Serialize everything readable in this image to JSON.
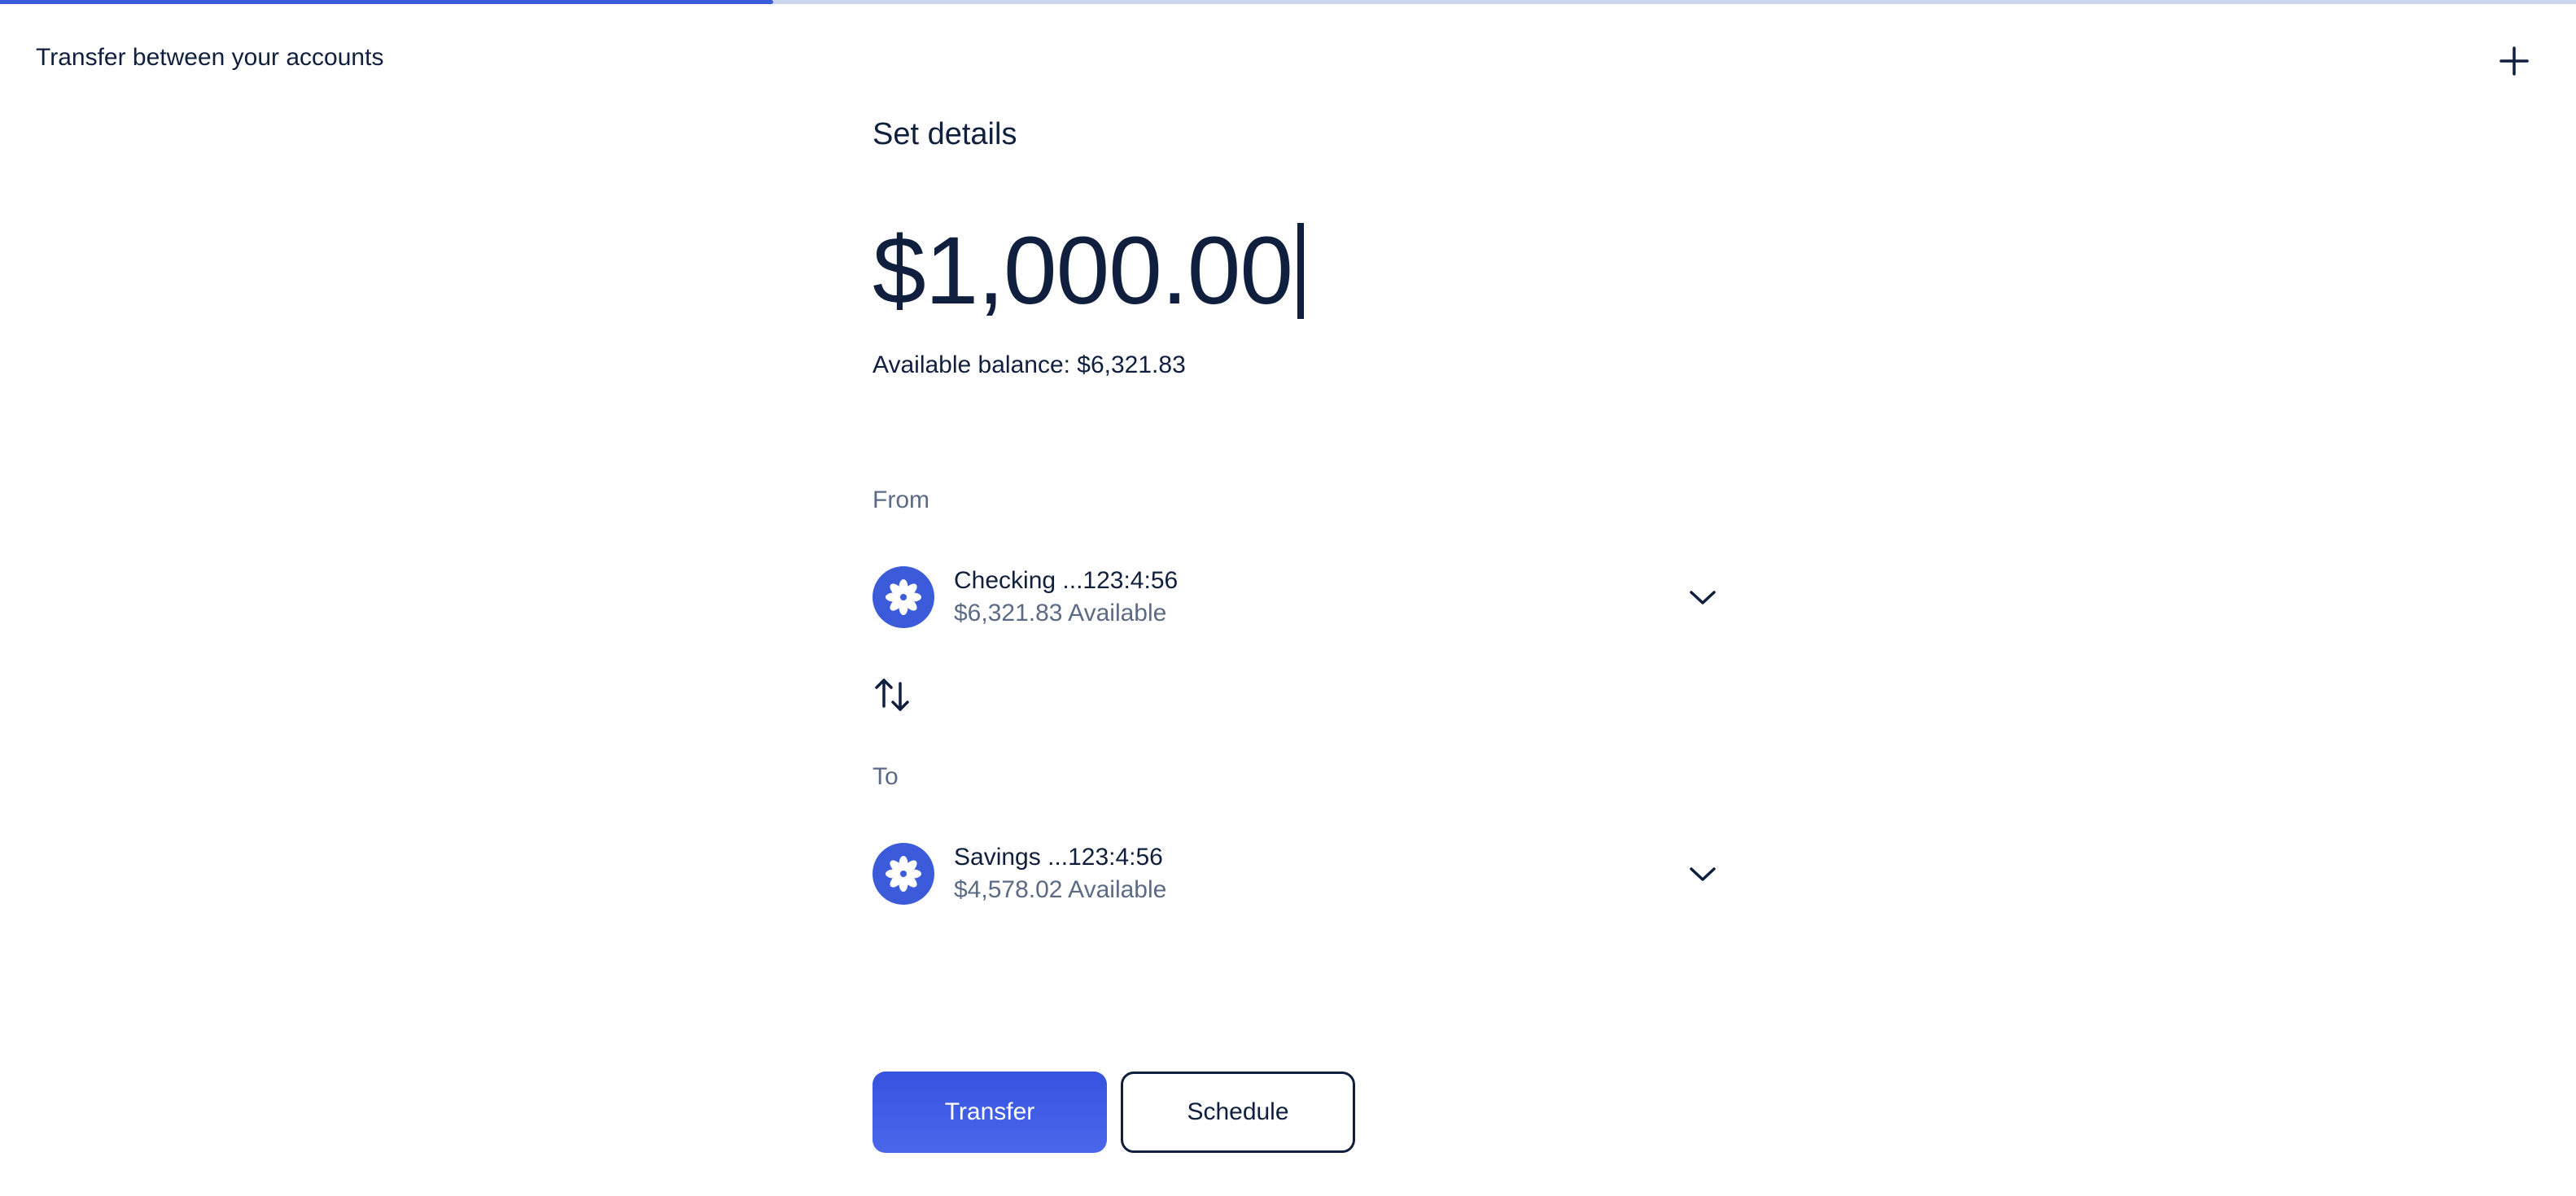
{
  "progress": {
    "fraction": 0.3
  },
  "header": {
    "title": "Transfer between your accounts",
    "close_icon": "plus-icon"
  },
  "main": {
    "section_title": "Set details",
    "amount": "$1,000.00",
    "available_balance": "Available balance: $6,321.83",
    "from": {
      "label": "From",
      "account_name": "Checking ...123:4:56",
      "account_balance": "$6,321.83 Available"
    },
    "to": {
      "label": "To",
      "account_name": "Savings ...123:4:56",
      "account_balance": "$4,578.02 Available"
    },
    "actions": {
      "transfer_label": "Transfer",
      "schedule_label": "Schedule"
    }
  },
  "colors": {
    "accent": "#3b5bdb",
    "text": "#0f1f3d",
    "muted": "#5c6b85"
  }
}
